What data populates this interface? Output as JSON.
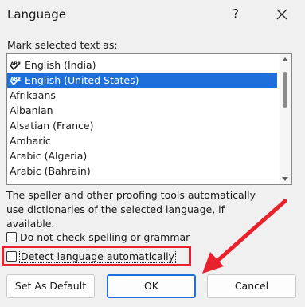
{
  "dialog": {
    "title": "Language",
    "help_label": "?"
  },
  "language_list": {
    "label": "Mark selected text as:",
    "items": [
      {
        "label": "English (India)",
        "spell_icon": true,
        "icon_text": "ABC"
      },
      {
        "label": "English (United States)",
        "spell_icon": true,
        "icon_text": "ABC",
        "selected": true
      },
      {
        "label": "Afrikaans"
      },
      {
        "label": "Albanian"
      },
      {
        "label": "Alsatian (France)"
      },
      {
        "label": "Amharic"
      },
      {
        "label": "Arabic (Algeria)"
      },
      {
        "label": "Arabic (Bahrain)"
      }
    ]
  },
  "description": "The speller and other proofing tools automatically use dictionaries of the selected language, if available.",
  "options": {
    "no_check_label": "Do not check spelling or grammar",
    "no_check_checked": false,
    "detect_label": "Detect language automatically",
    "detect_checked": false
  },
  "buttons": {
    "default_label": "Set As Default",
    "ok_label": "OK",
    "cancel_label": "Cancel"
  },
  "colors": {
    "selection": "#1e6fdc",
    "annotation": "#e8212c"
  }
}
